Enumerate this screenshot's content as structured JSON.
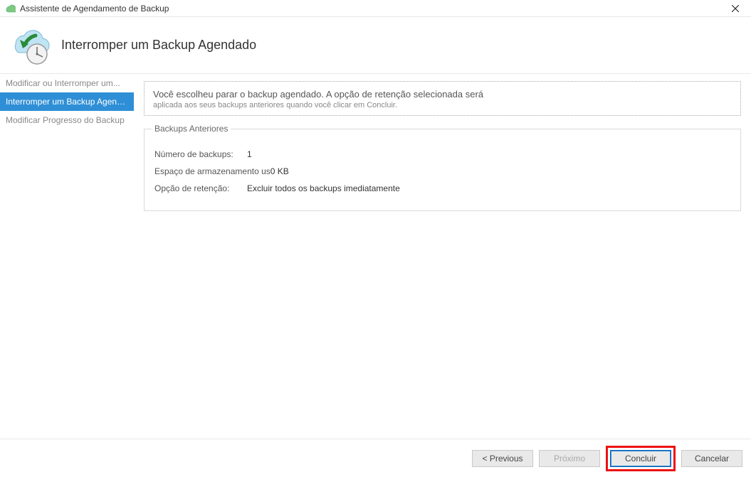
{
  "window": {
    "title": "Assistente de Agendamento de Backup"
  },
  "header": {
    "title": "Interromper um Backup Agendado"
  },
  "sidebar": {
    "items": [
      {
        "label": "Modificar ou Interromper um..."
      },
      {
        "label": "Interromper um Backup Agendado"
      },
      {
        "label": "Modificar Progresso do Backup"
      }
    ],
    "activeIndex": 1
  },
  "summary": {
    "line1": "Você escolheu parar o backup agendado. A opção de retenção selecionada será",
    "line2": "aplicada aos seus backups anteriores quando você clicar em Concluir."
  },
  "group": {
    "legend": "Backups Anteriores",
    "fields": {
      "numBackupsLabel": "Número de backups:",
      "numBackupsValue": "1",
      "storageLabel": "Espaço de armazenamento us",
      "storageValue": "0 KB",
      "retentionLabel": "Opção de retenção:",
      "retentionValue": "Excluir todos os backups imediatamente"
    }
  },
  "buttons": {
    "previous": "< Previous",
    "next": "Próximo",
    "finish": "Concluir",
    "cancel": "Cancelar"
  }
}
